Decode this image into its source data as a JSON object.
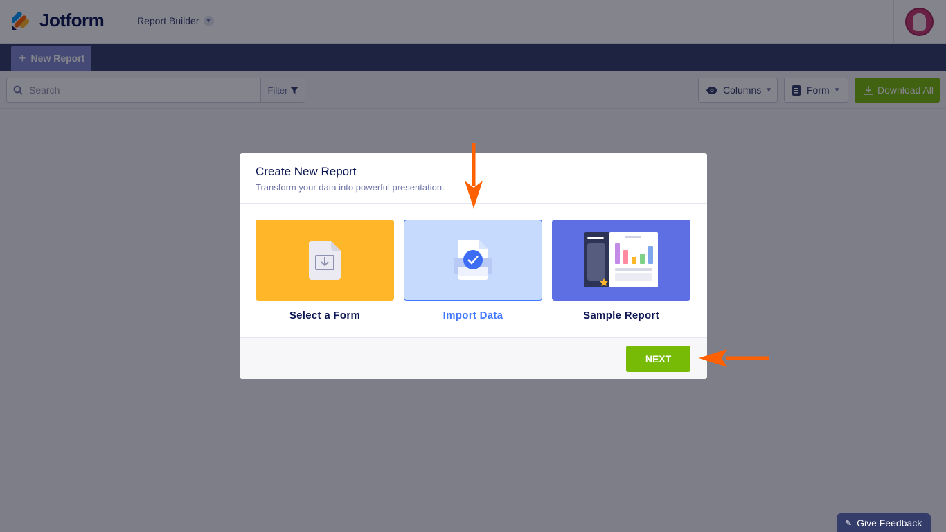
{
  "header": {
    "brand": "Jotform",
    "app_name": "Report Builder",
    "avatar_alt": "User avatar"
  },
  "nav": {
    "new_report_label": "New Report"
  },
  "toolbar": {
    "search_placeholder": "Search",
    "filter_label": "Filter",
    "columns_label": "Columns",
    "form_label": "Form",
    "download_label": "Download All"
  },
  "modal": {
    "title": "Create New Report",
    "subtitle": "Transform your data into powerful presentation.",
    "options": [
      {
        "label": "Select a Form",
        "icon": "form-download-icon",
        "selected": false
      },
      {
        "label": "Import Data",
        "icon": "import-data-icon",
        "selected": true
      },
      {
        "label": "Sample Report",
        "icon": "sample-report-icon",
        "selected": false
      }
    ],
    "next_label": "NEXT"
  },
  "feedback_label": "Give Feedback",
  "colors": {
    "primary_navy": "#343c6a",
    "accent_green": "#78bb07",
    "select_orange": "#ffb629",
    "import_blue": "#c5dafd",
    "sample_purple": "#5d6fe3",
    "annotation_orange": "#ff6100"
  }
}
